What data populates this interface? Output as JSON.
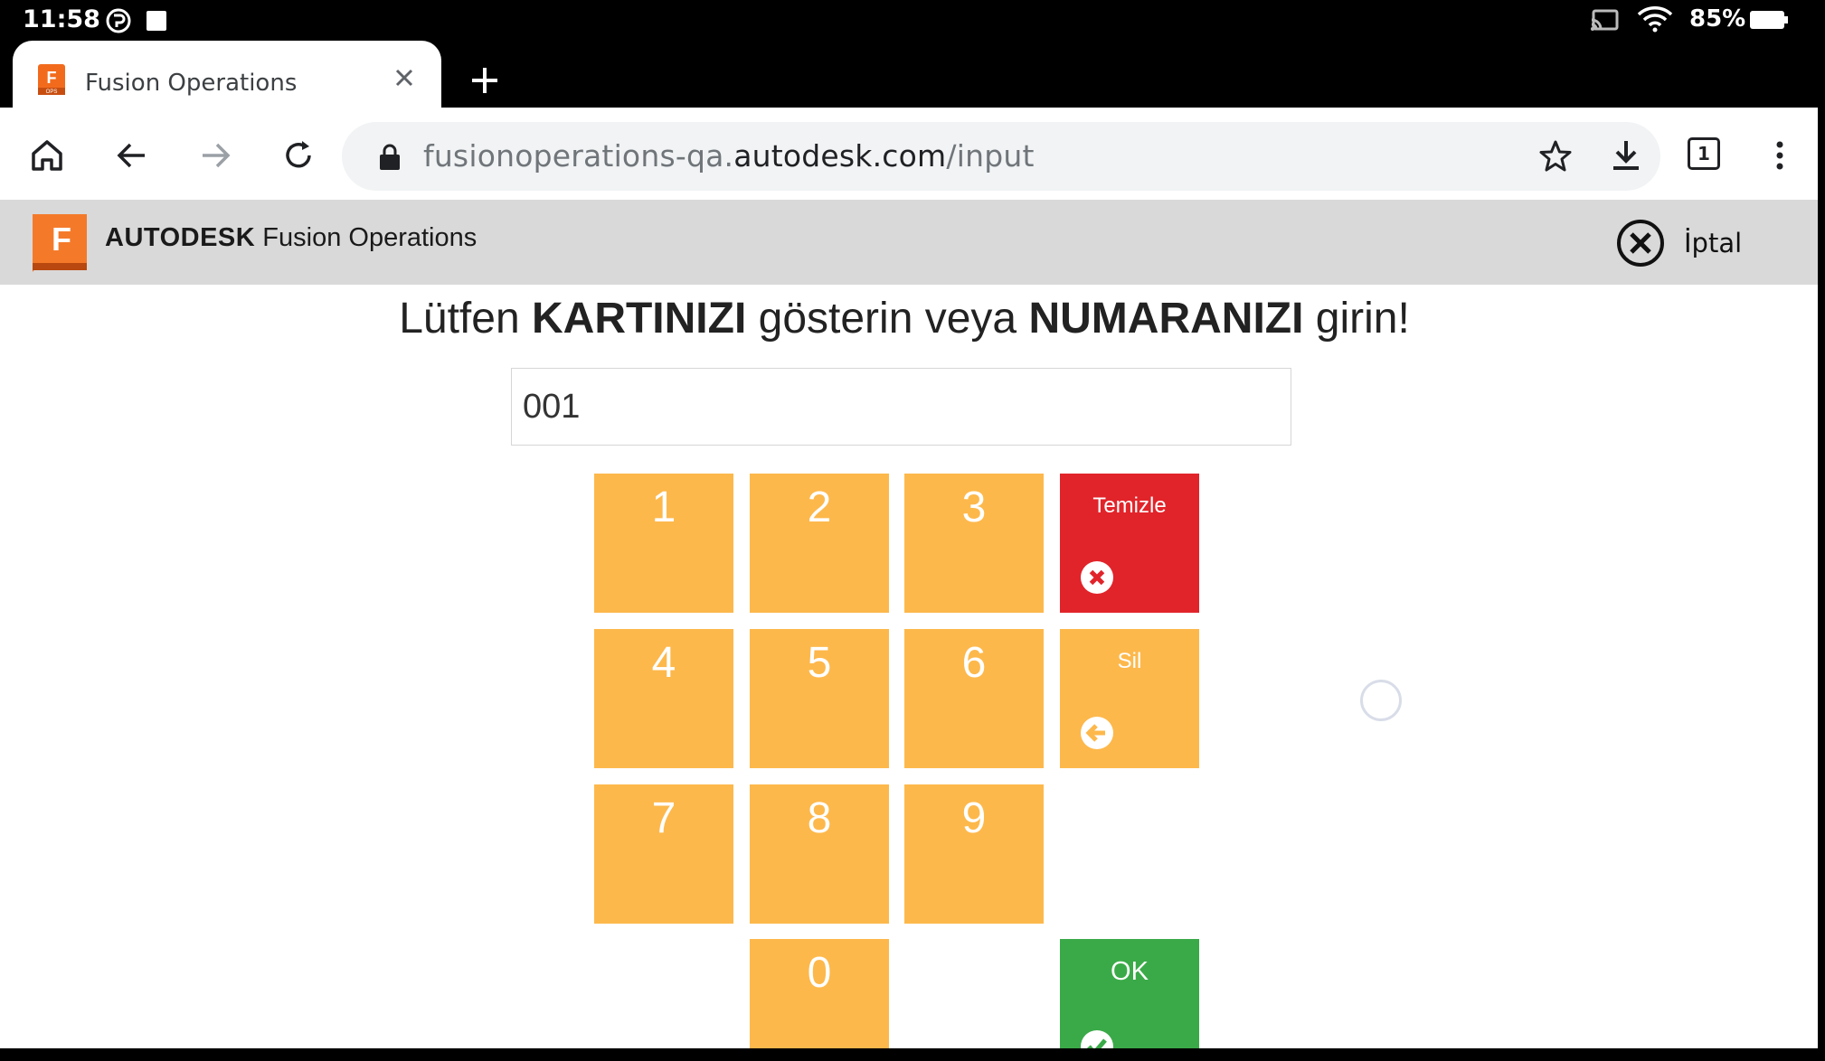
{
  "status_bar": {
    "time": "11:58",
    "battery": "85%"
  },
  "tab": {
    "title": "Fusion Operations",
    "favicon_letter": "F",
    "favicon_sub": "OPS"
  },
  "toolbar": {
    "url_prefix": "fusionoperations-qa.",
    "url_domain": "autodesk.com",
    "url_path": "/input",
    "tab_count": "1"
  },
  "app_header": {
    "logo_letter": "F",
    "brand": "AUTODESK",
    "product": "Fusion Operations",
    "cancel_label": "İptal"
  },
  "main": {
    "prompt": {
      "part1": "Lütfen ",
      "bold1": "KARTINIZI",
      "part2": " gösterin veya ",
      "bold2": "NUMARANIZI",
      "part3": " girin!"
    },
    "input_value": "001"
  },
  "keypad": {
    "k1": "1",
    "k2": "2",
    "k3": "3",
    "k4": "4",
    "k5": "5",
    "k6": "6",
    "k7": "7",
    "k8": "8",
    "k9": "9",
    "k0": "0",
    "clear_label": "Temizle",
    "delete_label": "Sil",
    "ok_label": "OK"
  },
  "colors": {
    "key": "#fdb84b",
    "clear": "#e1242a",
    "ok": "#3aaa48",
    "header": "#d9d9d9",
    "logo": "#f26b1d"
  }
}
